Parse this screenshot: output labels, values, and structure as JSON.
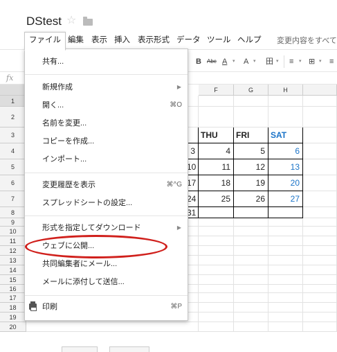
{
  "doc": {
    "title": "DStest",
    "star": "☆"
  },
  "menubar": {
    "items": [
      "ファイル",
      "編集",
      "表示",
      "挿入",
      "表示形式",
      "データ",
      "ツール",
      "ヘルプ"
    ],
    "save_status": "変更内容をすべて"
  },
  "toolbar": {
    "bold": "B",
    "strike": "Abc",
    "text_color": "A",
    "fill_color": "A",
    "borders": "田",
    "align": "≡",
    "merge": "⊞",
    "wrap": "≡"
  },
  "formula": {
    "fx": "fx"
  },
  "grid": {
    "columns": [
      "F",
      "G",
      "H"
    ],
    "rows": [
      "1",
      "2",
      "3",
      "4",
      "5",
      "6",
      "7",
      "8",
      "9",
      "10",
      "11",
      "12",
      "13",
      "14",
      "15",
      "16",
      "17",
      "18",
      "19",
      "20"
    ],
    "weekday_headers": [
      "THU",
      "FRI",
      "SAT"
    ],
    "partial_col_e": [
      "3",
      "10",
      "17",
      "24",
      "31"
    ],
    "col_f": [
      "4",
      "11",
      "18",
      "25"
    ],
    "col_g": [
      "5",
      "12",
      "19",
      "26"
    ],
    "col_h": [
      "6",
      "13",
      "20",
      "27"
    ]
  },
  "file_menu": {
    "items": [
      {
        "label": "共有...",
        "shortcut": ""
      },
      {
        "label": "新規作成",
        "shortcut": ""
      },
      {
        "label": "開く...",
        "shortcut": "⌘O"
      },
      {
        "label": "名前を変更...",
        "shortcut": ""
      },
      {
        "label": "コピーを作成...",
        "shortcut": ""
      },
      {
        "label": "インポート...",
        "shortcut": ""
      },
      {
        "label": "変更履歴を表示",
        "shortcut": "⌘^G"
      },
      {
        "label": "スプレッドシートの設定...",
        "shortcut": ""
      },
      {
        "label": "形式を指定してダウンロード",
        "shortcut": ""
      },
      {
        "label": "ウェブに公開...",
        "shortcut": ""
      },
      {
        "label": "共同編集者にメール...",
        "shortcut": ""
      },
      {
        "label": "メールに添付して送信...",
        "shortcut": ""
      },
      {
        "label": "印刷",
        "shortcut": "⌘P"
      }
    ]
  },
  "colors": {
    "accent_blue": "#1a73c8",
    "highlight_red": "#d0201c"
  }
}
